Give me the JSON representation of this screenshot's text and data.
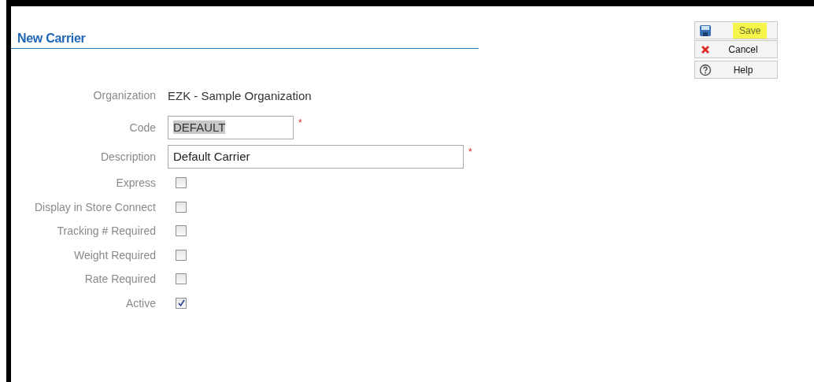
{
  "title": "New Carrier",
  "toolbar": [
    {
      "label": "Save",
      "kind": "save",
      "highlighted": true
    },
    {
      "label": "Cancel",
      "kind": "cancel",
      "highlighted": false
    },
    {
      "label": "Help",
      "kind": "help",
      "highlighted": false
    }
  ],
  "fields": [
    {
      "kind": "static",
      "label": "Organization",
      "value": "EZK - Sample Organization"
    },
    {
      "kind": "shorttext",
      "label": "Code",
      "value": "DEFAULT",
      "selected_text": true,
      "required_mark": "*"
    },
    {
      "kind": "longtext",
      "label": "Description",
      "value": "Default Carrier",
      "selected_text": false,
      "required_mark": "*"
    },
    {
      "kind": "checkbox",
      "label": "Express",
      "checked": false
    },
    {
      "kind": "checkbox",
      "label": "Display in Store Connect",
      "checked": false
    },
    {
      "kind": "checkbox",
      "label": "Tracking # Required",
      "checked": false
    },
    {
      "kind": "checkbox",
      "label": "Weight Required",
      "checked": false
    },
    {
      "kind": "checkbox",
      "label": "Rate Required",
      "checked": false
    },
    {
      "kind": "checkbox",
      "label": "Active",
      "checked": true
    }
  ]
}
